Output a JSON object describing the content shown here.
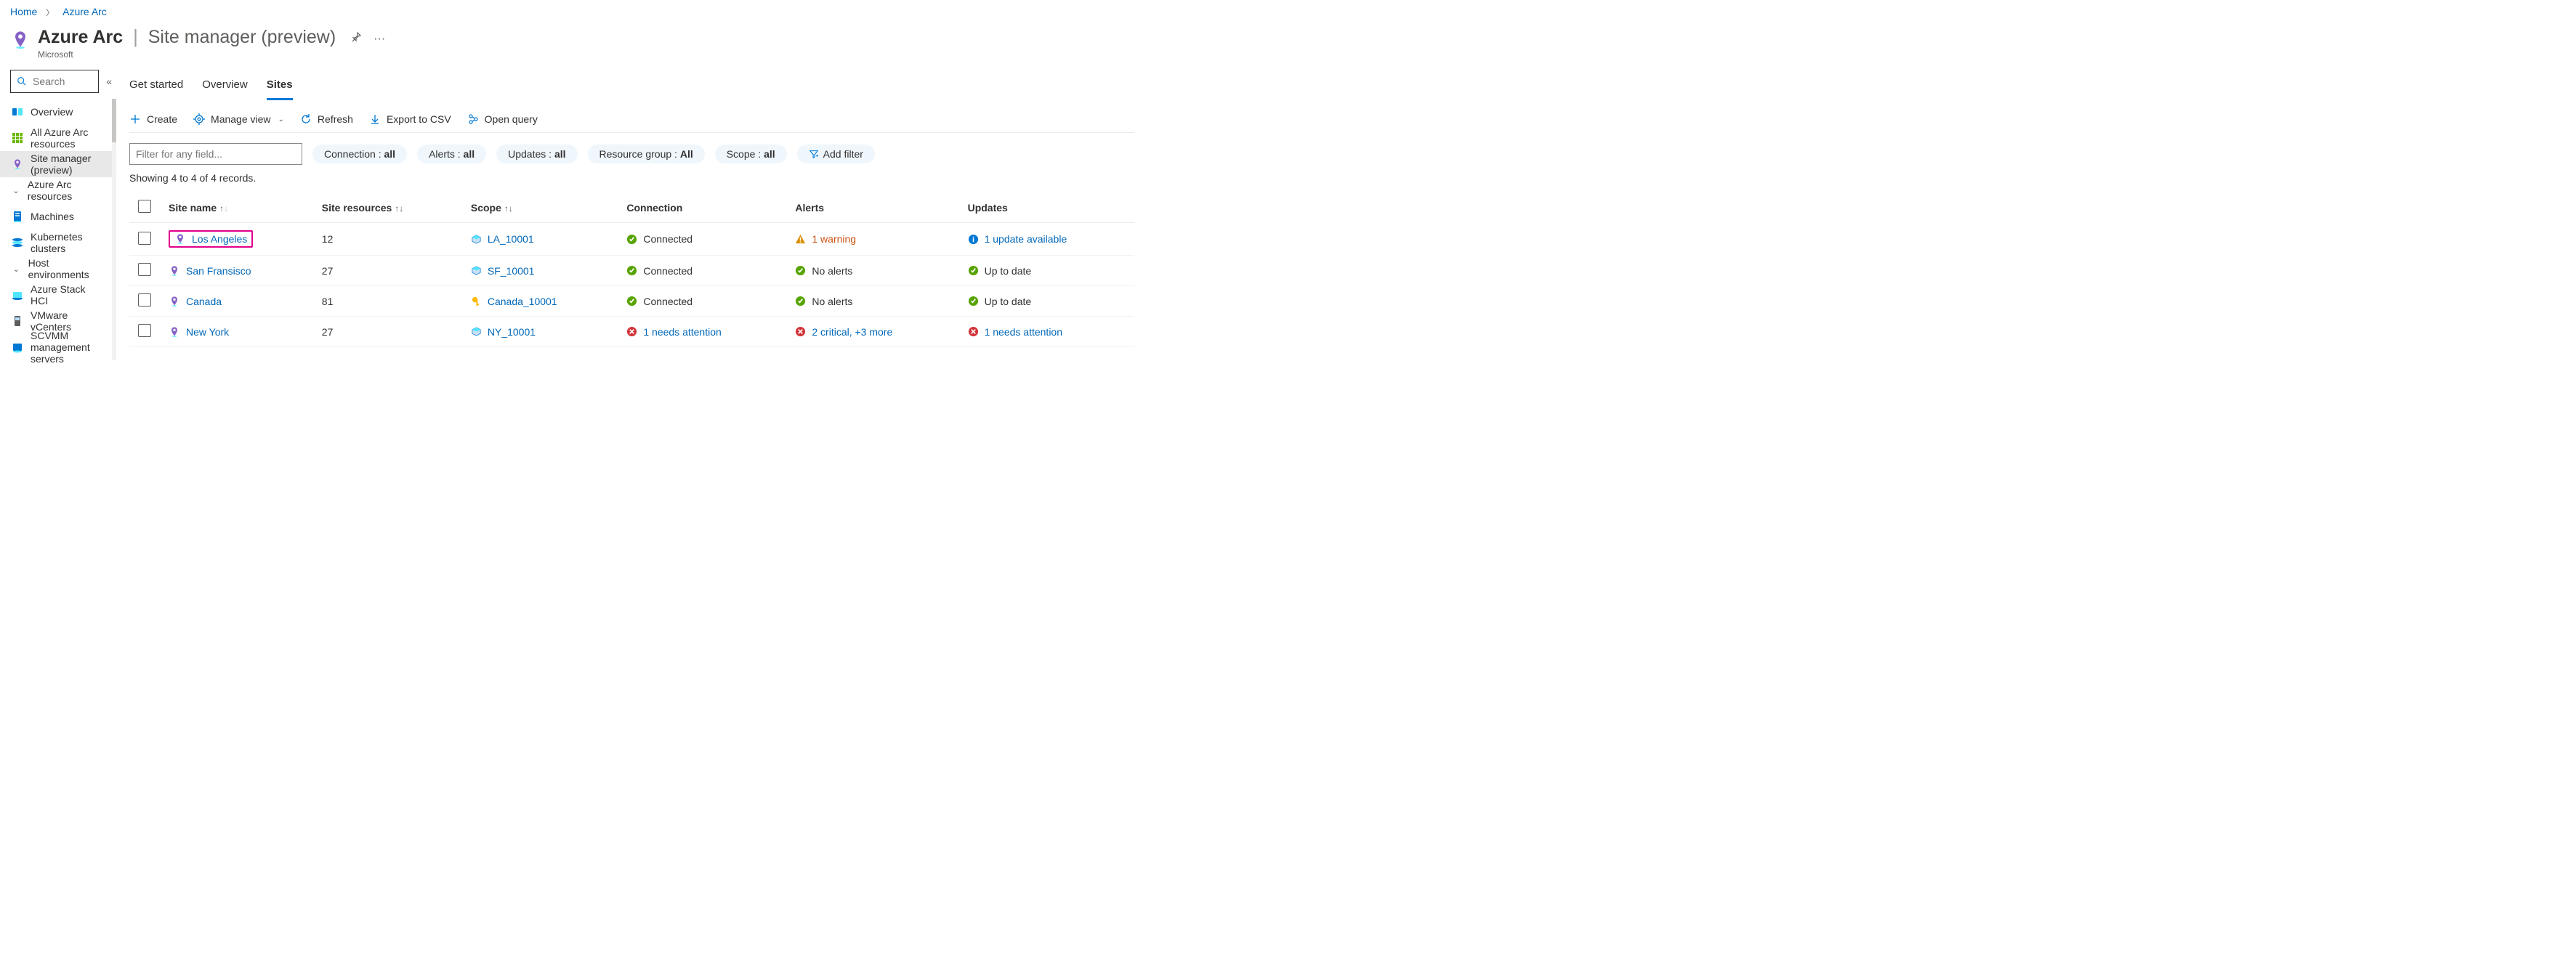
{
  "breadcrumb": {
    "home": "Home",
    "current": "Azure Arc"
  },
  "header": {
    "service": "Azure Arc",
    "page": "Site manager (preview)",
    "publisher": "Microsoft"
  },
  "sidebar": {
    "search_placeholder": "Search",
    "items": [
      {
        "label": "Overview",
        "icon": "overview"
      },
      {
        "label": "All Azure Arc resources",
        "icon": "grid"
      },
      {
        "label": "Site manager (preview)",
        "icon": "pin",
        "selected": true
      },
      {
        "label": "Azure Arc resources",
        "icon": "chev",
        "group": true
      },
      {
        "label": "Machines",
        "icon": "machine"
      },
      {
        "label": "Kubernetes clusters",
        "icon": "k8s"
      },
      {
        "label": "Host environments",
        "icon": "chev",
        "group": true
      },
      {
        "label": "Azure Stack HCI",
        "icon": "hci"
      },
      {
        "label": "VMware vCenters",
        "icon": "vmware"
      },
      {
        "label": "SCVMM management servers",
        "icon": "scvmm"
      }
    ]
  },
  "tabs": [
    {
      "label": "Get started"
    },
    {
      "label": "Overview"
    },
    {
      "label": "Sites",
      "active": true
    }
  ],
  "toolbar": {
    "create": "Create",
    "manage_view": "Manage view",
    "refresh": "Refresh",
    "export_csv": "Export to CSV",
    "open_query": "Open query"
  },
  "filterbar": {
    "placeholder": "Filter for any field...",
    "pills": [
      {
        "label": "Connection : ",
        "value": "all"
      },
      {
        "label": "Alerts : ",
        "value": "all"
      },
      {
        "label": "Updates : ",
        "value": "all"
      },
      {
        "label": "Resource group : ",
        "value": "All"
      },
      {
        "label": "Scope : ",
        "value": "all"
      }
    ],
    "add_filter": "Add filter"
  },
  "record_text": "Showing 4 to 4 of 4 records.",
  "columns": {
    "site_name": "Site name",
    "site_resources": "Site resources",
    "scope": "Scope",
    "connection": "Connection",
    "alerts": "Alerts",
    "updates": "Updates"
  },
  "rows": [
    {
      "name": "Los Angeles",
      "highlight": true,
      "resources": "12",
      "scope": "LA_10001",
      "scope_icon": "rg",
      "connection": {
        "icon": "ok",
        "text": "Connected",
        "link": false
      },
      "alerts": {
        "icon": "warn",
        "text": "1 warning",
        "link": true,
        "warn": true
      },
      "updates": {
        "icon": "info",
        "text": "1 update available",
        "link": true
      }
    },
    {
      "name": "San Fransisco",
      "resources": "27",
      "scope": "SF_10001",
      "scope_icon": "rg",
      "connection": {
        "icon": "ok",
        "text": "Connected",
        "link": false
      },
      "alerts": {
        "icon": "ok",
        "text": "No alerts",
        "link": false
      },
      "updates": {
        "icon": "ok",
        "text": "Up to date",
        "link": false
      }
    },
    {
      "name": "Canada",
      "resources": "81",
      "scope": "Canada_10001",
      "scope_icon": "key",
      "connection": {
        "icon": "ok",
        "text": "Connected",
        "link": false
      },
      "alerts": {
        "icon": "ok",
        "text": "No alerts",
        "link": false
      },
      "updates": {
        "icon": "ok",
        "text": "Up to date",
        "link": false
      }
    },
    {
      "name": "New York",
      "resources": "27",
      "scope": "NY_10001",
      "scope_icon": "rg",
      "connection": {
        "icon": "err",
        "text": "1 needs attention",
        "link": true
      },
      "alerts": {
        "icon": "err",
        "text": "2 critical, +3 more",
        "link": true
      },
      "updates": {
        "icon": "err",
        "text": "1 needs attention",
        "link": true
      }
    }
  ]
}
